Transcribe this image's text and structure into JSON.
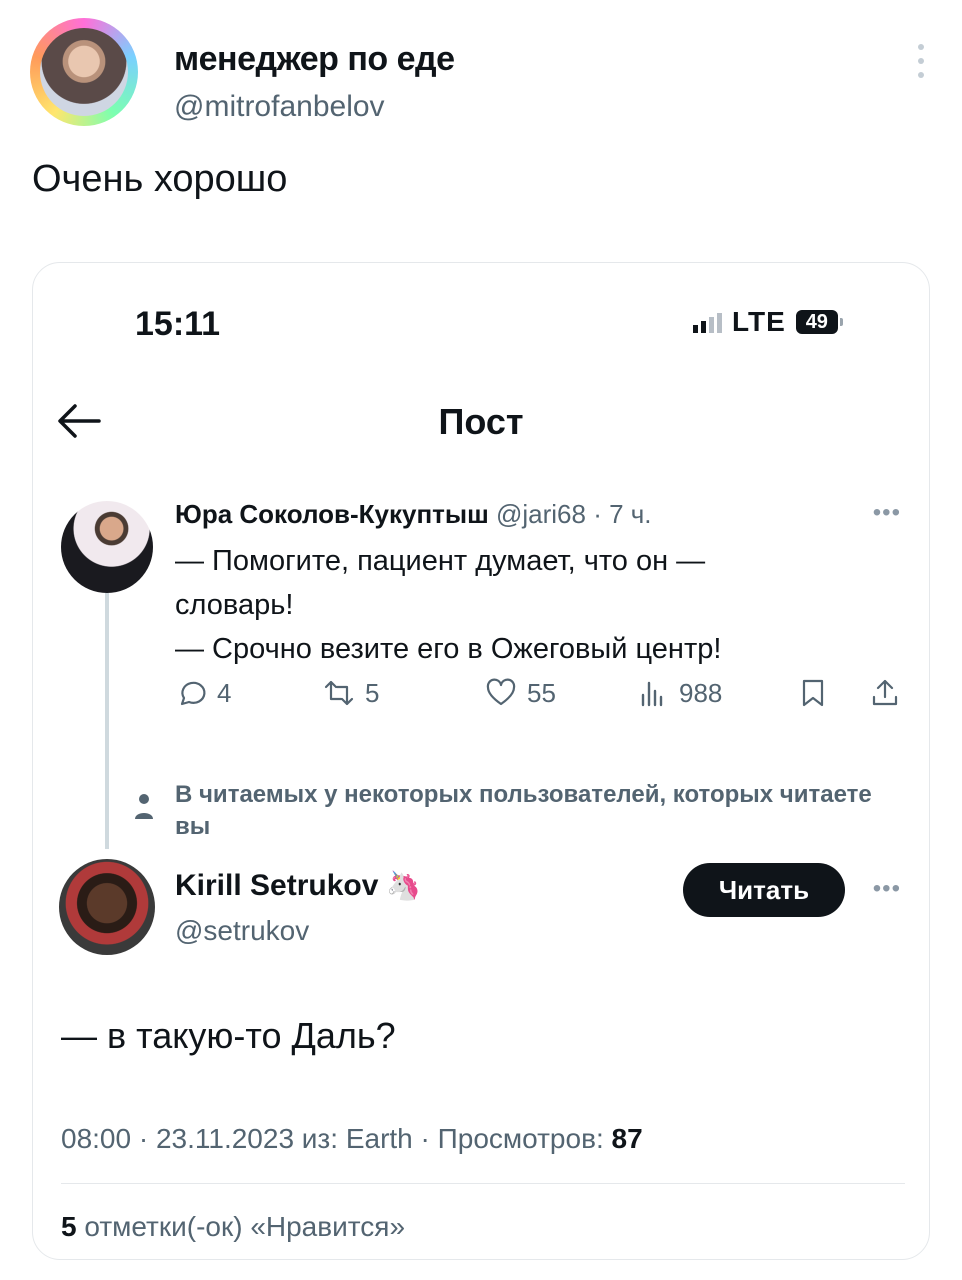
{
  "outer_post": {
    "author_name": "менеджер по еде",
    "author_handle": "@mitrofanbelov",
    "text": "Очень хорошо"
  },
  "screenshot": {
    "status_bar": {
      "time": "15:11",
      "network": "LTE",
      "battery": "49"
    },
    "nav": {
      "title": "Пост"
    },
    "quoted_tweet": {
      "author_name": "Юра Соколов-Кукуптыш",
      "meta": " @jari68 · 7 ч.",
      "lines": [
        "— Помогите, пациент думает, что он —",
        "словарь!",
        "— Срочно везите его в Ожеговый центр!"
      ],
      "replies": "4",
      "retweets": "5",
      "likes": "55",
      "views": "988"
    },
    "recommendation": "В читаемых у некоторых пользователей, которых читаете вы",
    "reply": {
      "author_name": "Kirill Setrukov",
      "emoji": "🦄",
      "author_handle": "@setrukov",
      "follow_label": "Читать",
      "text": "— в такую-то Даль?",
      "meta_prefix": "08:00 · 23.11.2023 из: Earth · Просмотров: ",
      "views": "87",
      "likes_count": "5",
      "likes_suffix": " отметки(-ок) «Нравится»"
    }
  },
  "colors": {
    "text": "#0f1419",
    "secondary": "#536471",
    "border": "#e5e8eb"
  }
}
